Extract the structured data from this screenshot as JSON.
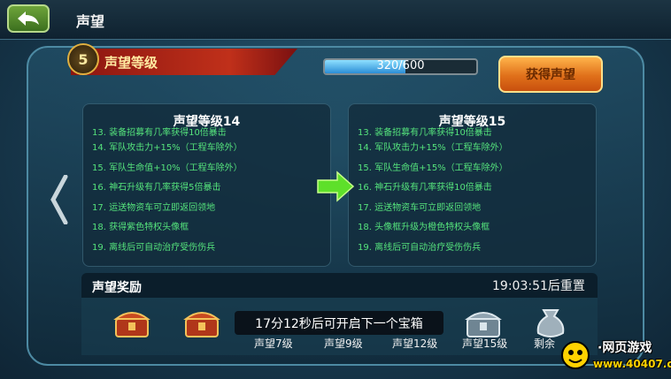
{
  "header": {
    "title": "声望"
  },
  "level": {
    "badge_number": "5",
    "title": "声望等级",
    "progress_text": "320/600",
    "progress_fraction": 0.533,
    "get_button": "获得声望"
  },
  "current_card": {
    "title": "声望等级14",
    "items": [
      "13. 装备招募有几率获得10倍暴击",
      "14. 军队攻击力+15%（工程车除外）",
      "15. 军队生命值+10%（工程车除外）",
      "16. 神石升级有几率获得5倍暴击",
      "17. 运送物资车可立即返回领地",
      "18. 获得紫色特权头像框",
      "19. 离线后可自动治疗受伤伤兵"
    ]
  },
  "next_card": {
    "title": "声望等级15",
    "items": [
      "13. 装备招募有几率获得10倍暴击",
      "14. 军队攻击力+15%（工程车除外）",
      "15. 军队生命值+15%（工程车除外）",
      "16. 神石升级有几率获得10倍暴击",
      "17. 运送物资车可立即返回领地",
      "18. 头像框升级为橙色特权头像框",
      "19. 离线后可自动治疗受伤伤兵"
    ]
  },
  "rewards": {
    "title": "声望奖励",
    "reset_text": "19:03:51后重置",
    "toast": "17分12秒后可开启下一个宝箱",
    "chests": [
      {
        "label": "声望7级"
      },
      {
        "label": "声望9级"
      },
      {
        "label": "声望12级"
      },
      {
        "label": "声望15级"
      },
      {
        "label": "剩余"
      }
    ]
  },
  "watermark": {
    "line1": "·网页游戏",
    "line2": "www.40407.com"
  },
  "colors": {
    "accent_green": "#55e37c",
    "button_orange": "#e0701a",
    "banner_red": "#c0301a"
  }
}
